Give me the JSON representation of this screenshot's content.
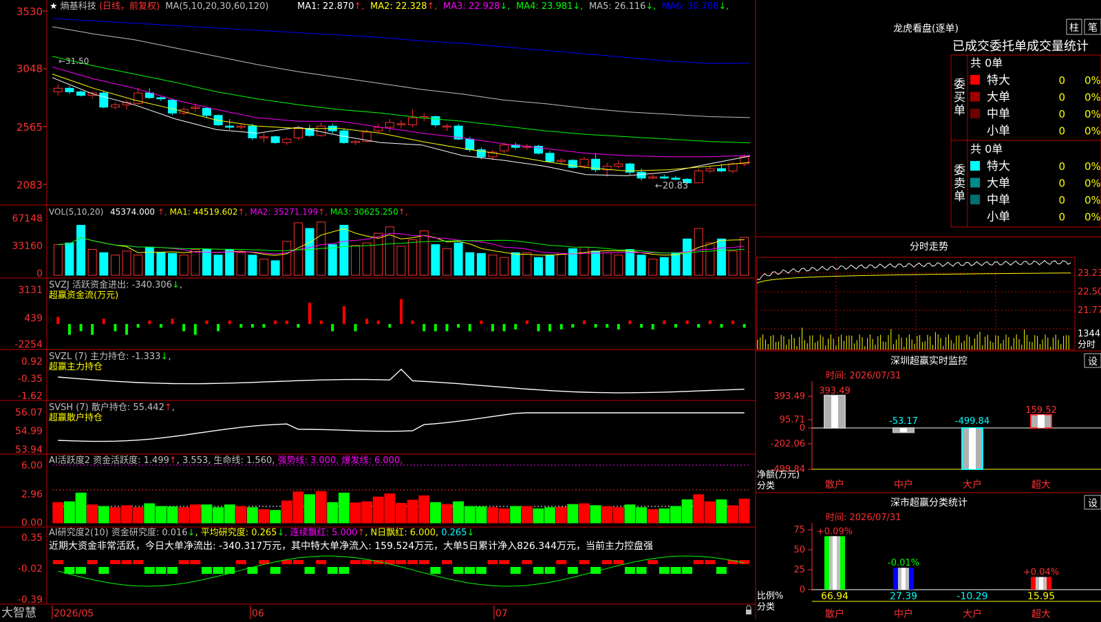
{
  "app": {
    "brand": "大智慧",
    "date_ticks": [
      "2026/05",
      "06",
      "07"
    ]
  },
  "header": {
    "star": "★",
    "stock_name": "熵基科技",
    "period": "(日线，前复权)",
    "ma_label": "MA(5,10,20,30,60,120)",
    "ma_values": [
      {
        "label": "MA1:",
        "value": "22.870",
        "arrow": "↑",
        "color": "#ffffff"
      },
      {
        "label": "MA2:",
        "value": "22.328",
        "arrow": "↑",
        "color": "#ffff00"
      },
      {
        "label": "MA3:",
        "value": "22.928",
        "arrow": "↓",
        "color": "#ff00ff"
      },
      {
        "label": "MA4:",
        "value": "23.981",
        "arrow": "↓",
        "color": "#00ff00"
      },
      {
        "label": "MA5:",
        "value": "26.116",
        "arrow": "↓",
        "color": "#c0c0c0"
      },
      {
        "label": "MA6:",
        "value": "30.708",
        "arrow": "↓",
        "color": "#0000ff"
      }
    ]
  },
  "price_axis": [
    "3530",
    "3048",
    "2565",
    "2083"
  ],
  "price_annotations": {
    "high": "←31.50",
    "low": "←20.83"
  },
  "vol_panel": {
    "axis": [
      "67148",
      "33160",
      "0"
    ],
    "label": "VOL(5,10,20)",
    "value": "45374.000",
    "ma": [
      {
        "label": "MA1:",
        "value": "44519.602",
        "arrow": "↑",
        "color": "#ffff00"
      },
      {
        "label": "MA2:",
        "value": "35271.199",
        "arrow": "↑",
        "color": "#ff00ff"
      },
      {
        "label": "MA3:",
        "value": "30625.250",
        "arrow": "↑",
        "color": "#00ff00"
      }
    ]
  },
  "svzj_panel": {
    "axis": [
      "3131",
      "439",
      "-2254"
    ],
    "line1": "SVZJ  活跃资金进出: -340.306",
    "arrow": "↓",
    "line2": "超赢资金流(万元)"
  },
  "svzl_panel": {
    "axis": [
      "0.92",
      "-0.35",
      "-1.62"
    ],
    "line1": "SVZL (7) 主力持仓: -1.333",
    "arrow": "↓",
    "line2": "超赢主力持仓"
  },
  "svsh_panel": {
    "axis": [
      "56.07",
      "54.99",
      "53.94"
    ],
    "line1": "SVSH (7) 散户持仓: 55.442",
    "arrow": "↑",
    "line2": "超赢散户持仓"
  },
  "ai_active_panel": {
    "axis": [
      "6.00",
      "2.96",
      "0.00"
    ],
    "parts": [
      {
        "text": "AI活跃度2 资金活跃度: 1.499",
        "color": "#c0c0c0"
      },
      {
        "text": "↑",
        "color": "#ff3030"
      },
      {
        "text": ", 3.553, 生命线: 1.560,",
        "color": "#c0c0c0"
      },
      {
        "text": " 强势线: 3.000, 爆发线: 6.000,",
        "color": "#ff00ff"
      }
    ]
  },
  "ai_research_panel": {
    "axis": [
      "0.35",
      "-0.02",
      "-0.39"
    ],
    "parts": [
      {
        "text": "AI研究度2(10) 资金研究度: 0.016",
        "color": "#c0c0c0"
      },
      {
        "text": "↓",
        "color": "#00ff00"
      },
      {
        "text": ", 平均研究度: 0.265",
        "color": "#ffff00"
      },
      {
        "text": "↓",
        "color": "#00ff00"
      },
      {
        "text": ", 连续飘红: 5.000",
        "color": "#ff00ff"
      },
      {
        "text": "↑",
        "color": "#ff3030"
      },
      {
        "text": ", N日飘红: 6.000, ",
        "color": "#ffff00"
      },
      {
        "text": "0.265",
        "color": "#00ffff"
      },
      {
        "text": "↓",
        "color": "#00ff00"
      }
    ],
    "note": "近期大资金非常活跃，今日大单净流出: -340.317万元，其中特大单净流入: 159.524万元，大单5日累计净入826.344万元，当前主力控盘强"
  },
  "dragon_tiger": {
    "title": "龙虎看盘(逐单)",
    "btn_zhu": "柱",
    "btn_bi": "笔",
    "subtitle": "已成交委托单成交量统计",
    "buy_label": "委买单",
    "sell_label": "委卖单",
    "buy_total": "共 0单",
    "sell_total": "共 0单",
    "buy_rows": [
      {
        "name": "特大",
        "qty": "0",
        "pct": "0%",
        "color": "#ff0000"
      },
      {
        "name": "大单",
        "qty": "0",
        "pct": "0%",
        "color": "#a00000"
      },
      {
        "name": "中单",
        "qty": "0",
        "pct": "0%",
        "color": "#700000"
      },
      {
        "name": "小单",
        "qty": "0",
        "pct": "0%",
        "color": "#000000"
      }
    ],
    "sell_rows": [
      {
        "name": "特大",
        "qty": "0",
        "pct": "0%",
        "color": "#00ffff"
      },
      {
        "name": "大单",
        "qty": "0",
        "pct": "0%",
        "color": "#008b8b"
      },
      {
        "name": "中单",
        "qty": "0",
        "pct": "0%",
        "color": "#006f6f"
      },
      {
        "name": "小单",
        "qty": "0",
        "pct": "0%",
        "color": "#000000"
      }
    ]
  },
  "intraday": {
    "title": "分时走势",
    "axis": [
      "23.23",
      "22.50",
      "21.77"
    ],
    "vol_label": "1344",
    "vol_unit": "分时"
  },
  "monitor": {
    "title": "深圳超赢实时监控",
    "btn": "设",
    "time": "时间: 2026/07/31",
    "axis": [
      "393.49",
      "95.71",
      "0",
      "-202.06",
      "-499.84"
    ],
    "axis_title_1": "净额(万元)",
    "axis_title_2": "分类",
    "bar_labels": [
      "393.49",
      "-53.17",
      "-499.84",
      "159.52"
    ],
    "categories": [
      "散户",
      "中户",
      "大户",
      "超大"
    ]
  },
  "classify": {
    "title": "深市超赢分类统计",
    "btn": "设",
    "time": "时间: 2026/07/31",
    "axis": [
      "75",
      "50",
      "25",
      "0"
    ],
    "axis_title_1": "比例%",
    "axis_title_2": "分类",
    "top_labels": [
      "+0.09%",
      "-0.01%",
      "",
      "+0.04%"
    ],
    "bottom_labels": [
      "66.94",
      "27.39",
      "-10.29",
      "15.95"
    ],
    "categories": [
      "散户",
      "中户",
      "大户",
      "超大"
    ]
  },
  "chart_data": [
    {
      "type": "candlestick",
      "title": "熵基科技 (日线，前复权)",
      "y_axis_ticks": [
        "3530",
        "3048",
        "2565",
        "2083"
      ],
      "high_label": "31.50",
      "low_label": "20.83",
      "candles": [
        [
          28.3,
          28.9,
          28.0,
          28.6
        ],
        [
          28.6,
          28.8,
          28.1,
          28.3
        ],
        [
          28.3,
          28.4,
          27.9,
          28.0
        ],
        [
          28.0,
          28.3,
          27.7,
          28.2
        ],
        [
          28.2,
          28.4,
          26.9,
          27.0
        ],
        [
          27.0,
          27.4,
          26.8,
          27.2
        ],
        [
          27.2,
          27.6,
          26.8,
          27.4
        ],
        [
          27.3,
          28.6,
          27.2,
          28.2
        ],
        [
          28.2,
          28.6,
          27.7,
          27.8
        ],
        [
          27.8,
          27.9,
          27.5,
          27.7
        ],
        [
          27.6,
          27.7,
          26.3,
          26.5
        ],
        [
          26.5,
          27.0,
          26.3,
          26.8
        ],
        [
          26.9,
          27.3,
          26.6,
          27.0
        ],
        [
          26.9,
          27.0,
          26.1,
          26.3
        ],
        [
          26.3,
          26.4,
          25.4,
          25.5
        ],
        [
          25.4,
          26.0,
          25.1,
          25.3
        ],
        [
          25.3,
          25.6,
          25.1,
          25.4
        ],
        [
          25.4,
          25.6,
          24.2,
          24.4
        ],
        [
          24.4,
          24.8,
          24.0,
          24.5
        ],
        [
          24.5,
          24.6,
          23.9,
          24.0
        ],
        [
          24.0,
          24.4,
          23.8,
          24.3
        ],
        [
          24.4,
          25.4,
          24.2,
          25.2
        ],
        [
          25.2,
          25.5,
          24.5,
          24.6
        ],
        [
          24.6,
          25.7,
          24.5,
          25.4
        ],
        [
          25.4,
          25.6,
          24.8,
          25.0
        ],
        [
          25.0,
          25.2,
          23.9,
          24.0
        ],
        [
          24.0,
          24.2,
          23.8,
          24.1
        ],
        [
          24.1,
          25.1,
          24.0,
          24.9
        ],
        [
          25.0,
          25.6,
          24.9,
          25.3
        ],
        [
          25.3,
          26.0,
          24.9,
          25.7
        ],
        [
          25.6,
          25.9,
          25.2,
          25.6
        ],
        [
          25.5,
          26.8,
          25.3,
          26.1
        ],
        [
          26.1,
          26.5,
          25.8,
          26.2
        ],
        [
          26.2,
          26.3,
          25.3,
          25.5
        ],
        [
          25.4,
          25.6,
          25.0,
          25.4
        ],
        [
          25.4,
          25.6,
          24.2,
          24.3
        ],
        [
          24.3,
          24.5,
          23.2,
          23.4
        ],
        [
          23.4,
          23.6,
          22.6,
          22.8
        ],
        [
          22.8,
          23.4,
          22.5,
          23.2
        ],
        [
          23.3,
          24.0,
          23.1,
          23.8
        ],
        [
          23.8,
          24.0,
          23.4,
          23.6
        ],
        [
          23.6,
          23.9,
          23.4,
          23.7
        ],
        [
          23.7,
          23.8,
          23.0,
          23.1
        ],
        [
          23.1,
          23.3,
          22.3,
          22.4
        ],
        [
          22.4,
          22.7,
          22.2,
          22.5
        ],
        [
          22.5,
          22.6,
          21.8,
          21.9
        ],
        [
          22.0,
          22.8,
          21.8,
          22.6
        ],
        [
          22.6,
          23.1,
          21.5,
          21.7
        ],
        [
          21.7,
          22.3,
          21.1,
          22.0
        ],
        [
          22.0,
          22.5,
          21.8,
          22.2
        ],
        [
          22.2,
          22.3,
          21.3,
          21.5
        ],
        [
          21.5,
          21.8,
          20.8,
          21.0
        ],
        [
          21.0,
          21.3,
          20.9,
          21.1
        ],
        [
          21.1,
          21.3,
          20.9,
          21.0
        ],
        [
          21.0,
          21.2,
          20.8,
          20.9
        ],
        [
          20.9,
          21.0,
          20.5,
          20.6
        ],
        [
          20.6,
          21.8,
          20.6,
          21.6
        ],
        [
          21.6,
          22.0,
          21.4,
          21.8
        ],
        [
          21.8,
          22.2,
          21.5,
          21.6
        ],
        [
          21.6,
          22.4,
          21.4,
          22.2
        ],
        [
          22.2,
          23.0,
          22.0,
          22.8
        ]
      ],
      "ma_series": [
        {
          "name": "MA1",
          "color": "#ffffff",
          "values": [
            29.5,
            28.1,
            27.2,
            26.0,
            25.1,
            24.8,
            25.3,
            24.6,
            24.0,
            23.8,
            22.9,
            22.5,
            22.0,
            21.3,
            21.2,
            21.5,
            22.2,
            22.87
          ]
        },
        {
          "name": "MA2",
          "color": "#ffff00",
          "values": [
            29.8,
            28.6,
            27.6,
            26.8,
            25.9,
            25.4,
            25.2,
            25.2,
            24.8,
            24.1,
            23.5,
            23.0,
            22.4,
            21.9,
            21.6,
            21.7,
            22.0,
            22.33
          ]
        },
        {
          "name": "MA3",
          "color": "#ff00ff",
          "values": [
            30.4,
            29.4,
            28.6,
            27.6,
            26.8,
            26.1,
            25.8,
            25.8,
            25.3,
            24.8,
            24.4,
            23.9,
            23.5,
            23.1,
            22.9,
            22.8,
            22.8,
            22.93
          ]
        },
        {
          "name": "MA4",
          "color": "#00ff00",
          "values": [
            31.3,
            30.5,
            29.8,
            29.1,
            28.3,
            27.7,
            27.2,
            26.8,
            26.5,
            26.1,
            25.8,
            25.4,
            25.0,
            24.7,
            24.5,
            24.3,
            24.1,
            23.98
          ]
        },
        {
          "name": "MA5",
          "color": "#c0c0c0",
          "values": [
            33.8,
            33.2,
            32.7,
            32.0,
            31.3,
            30.6,
            30.0,
            29.5,
            29.0,
            28.5,
            28.1,
            27.6,
            27.3,
            26.9,
            26.6,
            26.4,
            26.2,
            26.12
          ]
        },
        {
          "name": "MA6",
          "color": "#0000ff",
          "values": [
            34.5,
            34.3,
            34.1,
            33.9,
            33.7,
            33.5,
            33.3,
            33.1,
            32.9,
            32.6,
            32.4,
            32.1,
            31.8,
            31.5,
            31.2,
            30.9,
            30.7,
            30.71
          ]
        }
      ]
    },
    {
      "type": "bar",
      "title": "VOL(5,10,20)",
      "values": [
        38,
        40,
        62,
        32,
        28,
        25,
        30,
        25,
        35,
        28,
        27,
        25,
        32,
        32,
        25,
        32,
        28,
        25,
        20,
        18,
        42,
        65,
        58,
        66,
        38,
        62,
        37,
        40,
        52,
        60,
        36,
        44,
        55,
        38,
        33,
        40,
        28,
        27,
        25,
        22,
        28,
        28,
        22,
        25,
        26,
        33,
        35,
        30,
        28,
        25,
        32,
        25,
        20,
        22,
        28,
        45,
        58,
        40,
        45,
        30,
        47
      ],
      "ylim": [
        0,
        67148
      ]
    }
  ]
}
